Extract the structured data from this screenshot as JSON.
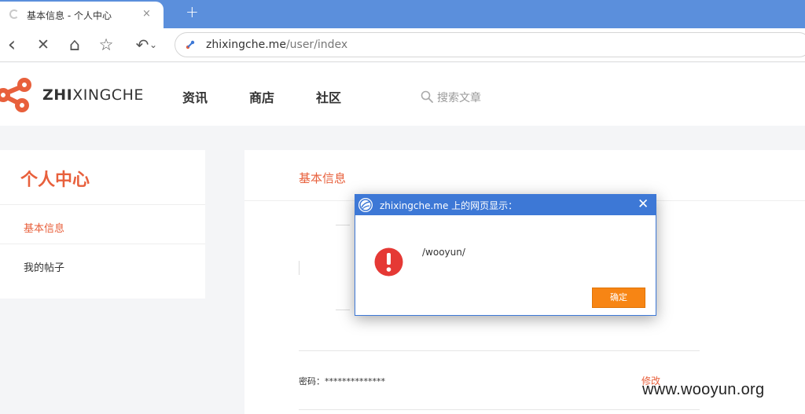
{
  "browser": {
    "tab_title": "基本信息 - 个人中心",
    "tab_close": "×",
    "new_tab": "+",
    "toolbar": {
      "back_icon": "‹",
      "stop_icon": "✕",
      "home_icon": "⌂",
      "bookmark_icon": "☆",
      "undo_icon": "↶",
      "undo_dropdown": "⌄"
    },
    "url": {
      "host": "zhixingche.me",
      "path": "/user/index"
    }
  },
  "site": {
    "logo": {
      "bold": "ZHI",
      "rest": "XINGCHE",
      "color": "#e8603c"
    },
    "nav": [
      "资讯",
      "商店",
      "社区"
    ],
    "search_placeholder": "搜索文章"
  },
  "sidebar": {
    "title": "个人中心",
    "items": [
      {
        "label": "基本信息",
        "active": true
      },
      {
        "label": "我的帖子",
        "active": false
      }
    ]
  },
  "main": {
    "heading": "基本信息",
    "password_label": "密码：**************",
    "edit_label": "修改"
  },
  "dialog": {
    "title": "zhixingche.me 上的网页显示：",
    "close": "✕",
    "message": "/wooyun/",
    "ok_label": "确定",
    "accent": "#3d78d6",
    "ok_color": "#f78514"
  },
  "watermark": "www.wooyun.org"
}
